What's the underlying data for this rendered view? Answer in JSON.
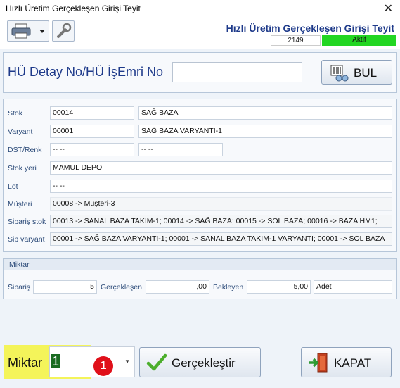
{
  "window": {
    "title": "Hızlı Üretim Gerçekleşen Girişi Teyit",
    "close_glyph": "✕"
  },
  "header": {
    "title": "Hızlı Üretim Gerçekleşen Girişi Teyit",
    "code": "2149",
    "status": "Aktif",
    "status_color": "#22d622"
  },
  "search": {
    "label": "HÜ Detay No/HÜ İşEmri No",
    "value": "",
    "button": "BUL"
  },
  "details": {
    "stok_label": "Stok",
    "stok_code": "00014",
    "stok_name": "SAĞ BAZA",
    "varyant_label": "Varyant",
    "varyant_code": "00001",
    "varyant_name": "SAĞ BAZA VARYANTI-1",
    "dst_label": "DST/Renk",
    "dst_1": "-- --",
    "dst_2": "-- --",
    "stokyeri_label": "Stok yeri",
    "stokyeri": "MAMUL DEPO",
    "lot_label": "Lot",
    "lot": "-- --",
    "musteri_label": "Müşteri",
    "musteri": "00008 -> Müşteri-3",
    "siparis_stok_label": "Sipariş stok",
    "siparis_stok": "00013 -> SANAL BAZA TAKIM-1;  00014 -> SAĞ BAZA;  00015 -> SOL BAZA;  00016 -> BAZA HM1;",
    "sip_varyant_label": "Sip varyant",
    "sip_varyant": "00001 -> SAĞ BAZA VARYANTI-1;  00001 -> SANAL BAZA TAKIM-1 VARYANTI;  00001 -> SOL BAZA"
  },
  "miktar_group": {
    "title": "Miktar",
    "siparis_label": "Sipariş",
    "siparis": "5",
    "gerceklesen_label": "Gerçekleşen",
    "gerceklesen": ",00",
    "bekleyen_label": "Bekleyen",
    "bekleyen": "5,00",
    "unit": "Adet"
  },
  "footer": {
    "miktar_label": "Miktar",
    "miktar_value": "1",
    "marker": "1",
    "confirm_button": "Gerçekleştir",
    "close_button": "KAPAT",
    "highlight_color": "#f4f45a",
    "marker_color": "#e0101a"
  }
}
